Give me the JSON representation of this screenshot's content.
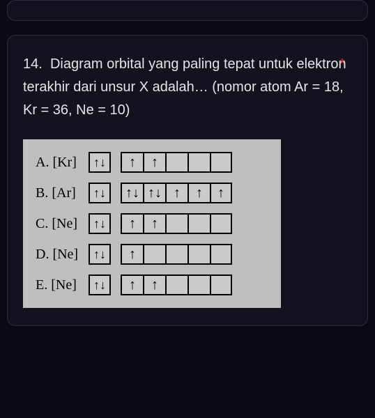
{
  "question": {
    "number": "14.",
    "text": "Diagram orbital yang paling tepat untuk elektron terakhir dari unsur X adalah… (nomor atom Ar = 18, Kr = 36, Ne = 10)",
    "required": "*"
  },
  "options": [
    {
      "label": "A. [Kr]",
      "single": "↑↓",
      "group": [
        "↑",
        "↑",
        "",
        "",
        ""
      ]
    },
    {
      "label": "B. [Ar]",
      "single": "↑↓",
      "group": [
        "↑↓",
        "↑↓",
        "↑",
        "↑",
        "↑"
      ]
    },
    {
      "label": "C. [Ne]",
      "single": "↑↓",
      "group": [
        "↑",
        "↑",
        "",
        "",
        ""
      ]
    },
    {
      "label": "D. [Ne]",
      "single": "↑↓",
      "group": [
        "↑",
        "",
        "",
        "",
        ""
      ]
    },
    {
      "label": "E. [Ne]",
      "single": "↑↓",
      "group": [
        "↑",
        "↑",
        "",
        "",
        ""
      ]
    }
  ]
}
